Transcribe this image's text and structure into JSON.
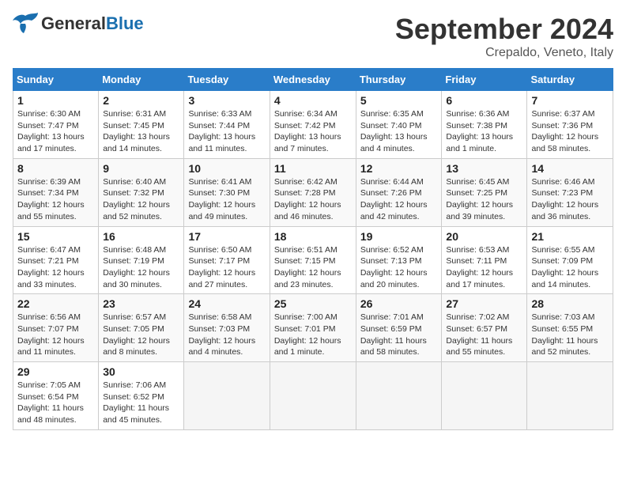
{
  "header": {
    "logo_general": "General",
    "logo_blue": "Blue",
    "month": "September 2024",
    "location": "Crepaldo, Veneto, Italy"
  },
  "weekdays": [
    "Sunday",
    "Monday",
    "Tuesday",
    "Wednesday",
    "Thursday",
    "Friday",
    "Saturday"
  ],
  "weeks": [
    [
      {
        "day": "1",
        "info": "Sunrise: 6:30 AM\nSunset: 7:47 PM\nDaylight: 13 hours and 17 minutes."
      },
      {
        "day": "2",
        "info": "Sunrise: 6:31 AM\nSunset: 7:45 PM\nDaylight: 13 hours and 14 minutes."
      },
      {
        "day": "3",
        "info": "Sunrise: 6:33 AM\nSunset: 7:44 PM\nDaylight: 13 hours and 11 minutes."
      },
      {
        "day": "4",
        "info": "Sunrise: 6:34 AM\nSunset: 7:42 PM\nDaylight: 13 hours and 7 minutes."
      },
      {
        "day": "5",
        "info": "Sunrise: 6:35 AM\nSunset: 7:40 PM\nDaylight: 13 hours and 4 minutes."
      },
      {
        "day": "6",
        "info": "Sunrise: 6:36 AM\nSunset: 7:38 PM\nDaylight: 13 hours and 1 minute."
      },
      {
        "day": "7",
        "info": "Sunrise: 6:37 AM\nSunset: 7:36 PM\nDaylight: 12 hours and 58 minutes."
      }
    ],
    [
      {
        "day": "8",
        "info": "Sunrise: 6:39 AM\nSunset: 7:34 PM\nDaylight: 12 hours and 55 minutes."
      },
      {
        "day": "9",
        "info": "Sunrise: 6:40 AM\nSunset: 7:32 PM\nDaylight: 12 hours and 52 minutes."
      },
      {
        "day": "10",
        "info": "Sunrise: 6:41 AM\nSunset: 7:30 PM\nDaylight: 12 hours and 49 minutes."
      },
      {
        "day": "11",
        "info": "Sunrise: 6:42 AM\nSunset: 7:28 PM\nDaylight: 12 hours and 46 minutes."
      },
      {
        "day": "12",
        "info": "Sunrise: 6:44 AM\nSunset: 7:26 PM\nDaylight: 12 hours and 42 minutes."
      },
      {
        "day": "13",
        "info": "Sunrise: 6:45 AM\nSunset: 7:25 PM\nDaylight: 12 hours and 39 minutes."
      },
      {
        "day": "14",
        "info": "Sunrise: 6:46 AM\nSunset: 7:23 PM\nDaylight: 12 hours and 36 minutes."
      }
    ],
    [
      {
        "day": "15",
        "info": "Sunrise: 6:47 AM\nSunset: 7:21 PM\nDaylight: 12 hours and 33 minutes."
      },
      {
        "day": "16",
        "info": "Sunrise: 6:48 AM\nSunset: 7:19 PM\nDaylight: 12 hours and 30 minutes."
      },
      {
        "day": "17",
        "info": "Sunrise: 6:50 AM\nSunset: 7:17 PM\nDaylight: 12 hours and 27 minutes."
      },
      {
        "day": "18",
        "info": "Sunrise: 6:51 AM\nSunset: 7:15 PM\nDaylight: 12 hours and 23 minutes."
      },
      {
        "day": "19",
        "info": "Sunrise: 6:52 AM\nSunset: 7:13 PM\nDaylight: 12 hours and 20 minutes."
      },
      {
        "day": "20",
        "info": "Sunrise: 6:53 AM\nSunset: 7:11 PM\nDaylight: 12 hours and 17 minutes."
      },
      {
        "day": "21",
        "info": "Sunrise: 6:55 AM\nSunset: 7:09 PM\nDaylight: 12 hours and 14 minutes."
      }
    ],
    [
      {
        "day": "22",
        "info": "Sunrise: 6:56 AM\nSunset: 7:07 PM\nDaylight: 12 hours and 11 minutes."
      },
      {
        "day": "23",
        "info": "Sunrise: 6:57 AM\nSunset: 7:05 PM\nDaylight: 12 hours and 8 minutes."
      },
      {
        "day": "24",
        "info": "Sunrise: 6:58 AM\nSunset: 7:03 PM\nDaylight: 12 hours and 4 minutes."
      },
      {
        "day": "25",
        "info": "Sunrise: 7:00 AM\nSunset: 7:01 PM\nDaylight: 12 hours and 1 minute."
      },
      {
        "day": "26",
        "info": "Sunrise: 7:01 AM\nSunset: 6:59 PM\nDaylight: 11 hours and 58 minutes."
      },
      {
        "day": "27",
        "info": "Sunrise: 7:02 AM\nSunset: 6:57 PM\nDaylight: 11 hours and 55 minutes."
      },
      {
        "day": "28",
        "info": "Sunrise: 7:03 AM\nSunset: 6:55 PM\nDaylight: 11 hours and 52 minutes."
      }
    ],
    [
      {
        "day": "29",
        "info": "Sunrise: 7:05 AM\nSunset: 6:54 PM\nDaylight: 11 hours and 48 minutes."
      },
      {
        "day": "30",
        "info": "Sunrise: 7:06 AM\nSunset: 6:52 PM\nDaylight: 11 hours and 45 minutes."
      },
      {
        "day": "",
        "info": ""
      },
      {
        "day": "",
        "info": ""
      },
      {
        "day": "",
        "info": ""
      },
      {
        "day": "",
        "info": ""
      },
      {
        "day": "",
        "info": ""
      }
    ]
  ]
}
